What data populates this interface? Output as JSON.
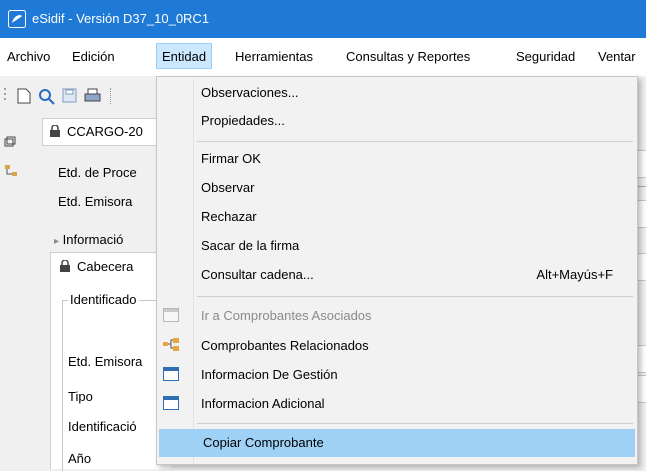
{
  "window": {
    "title": "eSidif - Versión D37_10_0RC1"
  },
  "menubar": {
    "items": [
      {
        "label": "Archivo"
      },
      {
        "label": "Edición"
      },
      {
        "label": "Entidad"
      },
      {
        "label": "Herramientas"
      },
      {
        "label": "Consultas y Reportes"
      },
      {
        "label": "Seguridad"
      },
      {
        "label": "Ventar"
      }
    ]
  },
  "toolbar": {
    "icons": [
      "new-document-icon",
      "search-icon",
      "save-icon",
      "print-icon"
    ]
  },
  "document": {
    "tab_label": "CCARGO-20",
    "fields": {
      "etd_proceso": "Etd. de Proce",
      "etd_emisora": "Etd. Emisora",
      "informacion": "Informació",
      "cabecera_tab": "Cabecera",
      "identificado": "Identificado",
      "etd_emisora2": "Etd. Emisora",
      "tipo": "Tipo",
      "identificacion": "Identificació",
      "anio": "Año"
    }
  },
  "entidad_menu": {
    "items": [
      {
        "label": "Observaciones...",
        "icon": ""
      },
      {
        "label": "Propiedades...",
        "icon": ""
      },
      {
        "label": "Firmar OK",
        "icon": ""
      },
      {
        "label": "Observar",
        "icon": ""
      },
      {
        "label": "Rechazar",
        "icon": ""
      },
      {
        "label": "Sacar de la firma",
        "icon": ""
      },
      {
        "label": "Consultar cadena...",
        "accelerator": "Alt+Mayús+F",
        "icon": ""
      },
      {
        "label": "Ir a Comprobantes Asociados",
        "icon": "window-icon",
        "disabled": true
      },
      {
        "label": "Comprobantes Relacionados",
        "icon": "hierarchy-icon"
      },
      {
        "label": "Informacion De Gestión",
        "icon": "window-icon"
      },
      {
        "label": "Informacion Adicional",
        "icon": "window-icon"
      },
      {
        "label": "Copiar Comprobante",
        "icon": "",
        "highlighted": true
      }
    ]
  },
  "colors": {
    "titlebar": "#1e7ad6",
    "menu_highlight": "#9fd0f5",
    "active_menu": "#cce8ff"
  }
}
